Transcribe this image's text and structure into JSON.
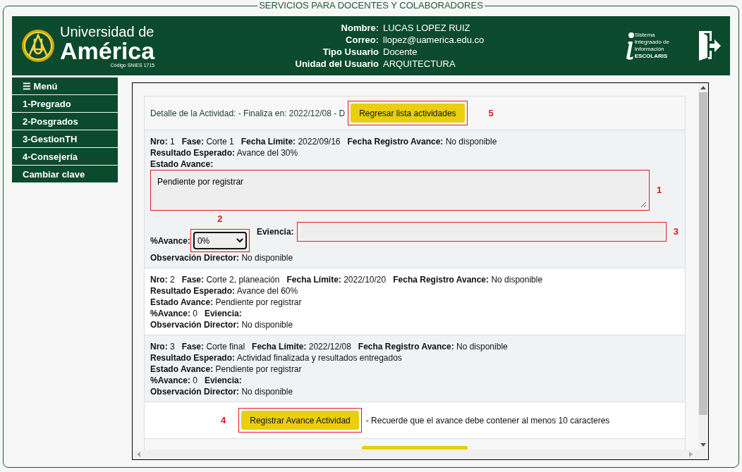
{
  "legend": "SERVICIOS PARA DOCENTES Y COLABORADORES",
  "header": {
    "logo": {
      "line1": "Universidad de",
      "line2": "América",
      "code": "Código SNIES 1715"
    },
    "user": [
      {
        "label": "Nombre:",
        "value": "LUCAS LOPEZ RUIZ"
      },
      {
        "label": "Correo:",
        "value": "llopez@uamerica.edu.co"
      },
      {
        "label": "Tipo Usuario",
        "value": "Docente"
      },
      {
        "label": "Unidad del Usuario",
        "value": "ARQUITECTURA"
      }
    ],
    "system": [
      "Sistema",
      "Integraado de",
      "Información",
      "ESCOLARIS"
    ]
  },
  "menu": [
    {
      "label": "☰ Menú"
    },
    {
      "label": "1-Pregrado"
    },
    {
      "label": "2-Posgrados"
    },
    {
      "label": "3-GestionTH"
    },
    {
      "label": "4-Consejería"
    },
    {
      "label": "Cambiar clave"
    }
  ],
  "detail": {
    "title": "Detalle de la Actividad: - Finaliza en: 2022/12/08 - D",
    "button": {
      "label": "Regresar lista actividades",
      "annotation": "5"
    },
    "activities": [
      {
        "shaded": true,
        "lines": [
          [
            {
              "kind": "text",
              "label": "Nro:",
              "value": "1"
            },
            {
              "kind": "text",
              "label": "Fase:",
              "value": "Corte 1"
            },
            {
              "kind": "text",
              "label": "Fecha Límite:",
              "value": "2022/09/16"
            },
            {
              "kind": "text",
              "label": "Fecha Registro Avance:",
              "value": "No disponible"
            }
          ],
          [
            {
              "kind": "text",
              "label": "Resultado Esperado:",
              "value": "Avance del 30%"
            }
          ],
          [
            {
              "kind": "textarea",
              "label": "Estado Avance:",
              "value": "Pendiente por registrar",
              "annotation": "1"
            }
          ],
          [
            {
              "kind": "select",
              "label": "%Avance:",
              "value": "0%",
              "annotation": "2"
            },
            {
              "kind": "input",
              "label": "Eviencia:",
              "annotation": "3"
            }
          ],
          [
            {
              "kind": "text",
              "label": "Observación Director:",
              "value": "No disponible"
            }
          ]
        ]
      },
      {
        "shaded": false,
        "lines": [
          [
            {
              "kind": "text",
              "label": "Nro:",
              "value": "2"
            },
            {
              "kind": "text",
              "label": "Fase:",
              "value": "Corte 2, planeación"
            },
            {
              "kind": "text",
              "label": "Fecha Límite:",
              "value": "2022/10/20"
            },
            {
              "kind": "text",
              "label": "Fecha Registro Avance:",
              "value": "No disponible"
            }
          ],
          [
            {
              "kind": "text",
              "label": "Resultado Esperado:",
              "value": "Avance del 60%"
            }
          ],
          [
            {
              "kind": "text",
              "label": "Estado Avance:",
              "value": "Pendiente por registrar"
            }
          ],
          [
            {
              "kind": "text",
              "label": "%Avance:",
              "value": "0"
            },
            {
              "kind": "text",
              "label": "Eviencia:"
            }
          ],
          [
            {
              "kind": "text",
              "label": "Observación Director:",
              "value": "No disponible"
            }
          ]
        ]
      },
      {
        "shaded": true,
        "lines": [
          [
            {
              "kind": "text",
              "label": "Nro:",
              "value": "3"
            },
            {
              "kind": "text",
              "label": "Fase:",
              "value": "Corte final"
            },
            {
              "kind": "text",
              "label": "Fecha Límite:",
              "value": "2022/12/08"
            },
            {
              "kind": "text",
              "label": "Fecha Registro Avance:",
              "value": "No disponible"
            }
          ],
          [
            {
              "kind": "text",
              "label": "Resultado Esperado:",
              "value": "Actividad finalizada y resultados entregados"
            }
          ],
          [
            {
              "kind": "text",
              "label": "Estado Avance:",
              "value": "Pendiente por registrar"
            }
          ],
          [
            {
              "kind": "text",
              "label": "%Avance:",
              "value": "0"
            },
            {
              "kind": "text",
              "label": "Eviencia:"
            }
          ],
          [
            {
              "kind": "text",
              "label": "Observación Director:",
              "value": "No disponible"
            }
          ]
        ]
      }
    ],
    "register": {
      "label": "Registrar Avance Actividad",
      "annotation": "4",
      "note": "- Recuerde que el avance debe contener al menos 10 caracteres"
    }
  }
}
